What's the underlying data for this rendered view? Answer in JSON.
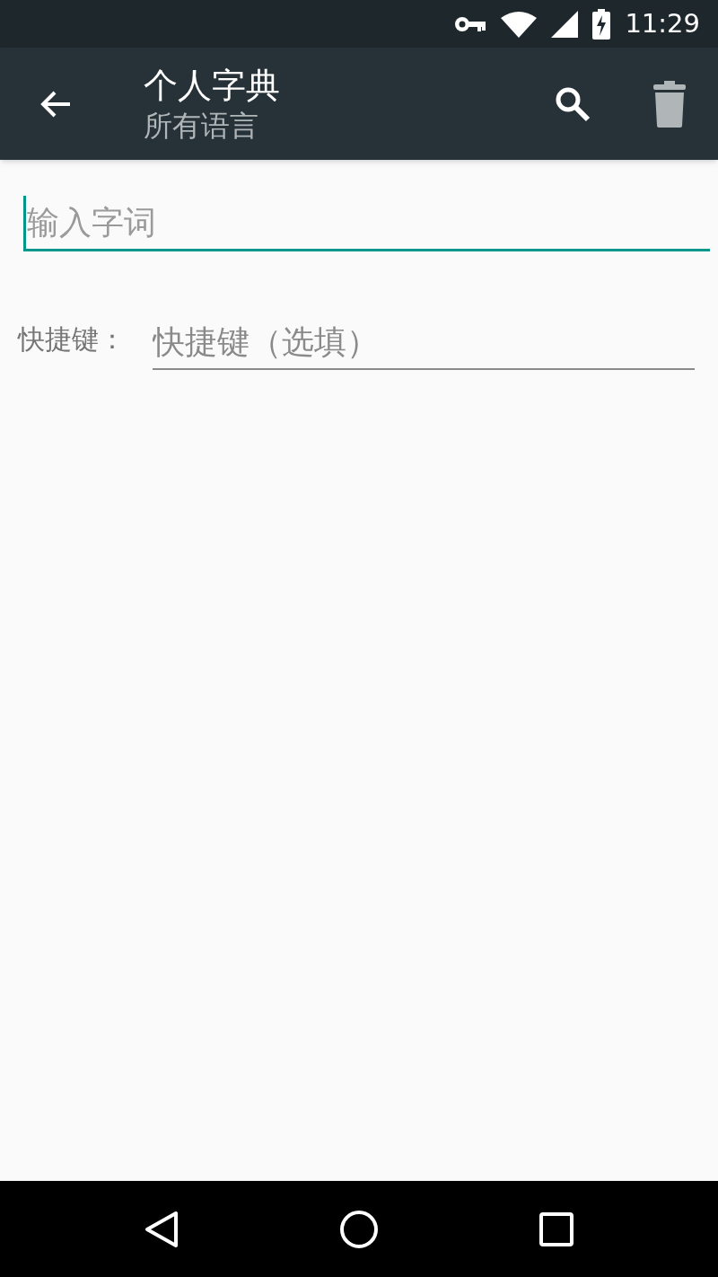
{
  "status_bar": {
    "time": "11:29"
  },
  "app_bar": {
    "title": "个人字典",
    "subtitle": "所有语言"
  },
  "word_field": {
    "placeholder": "输入字词",
    "focused": true
  },
  "shortcut": {
    "label": "快捷键：",
    "placeholder": "快捷键（选填）",
    "focused": false
  }
}
